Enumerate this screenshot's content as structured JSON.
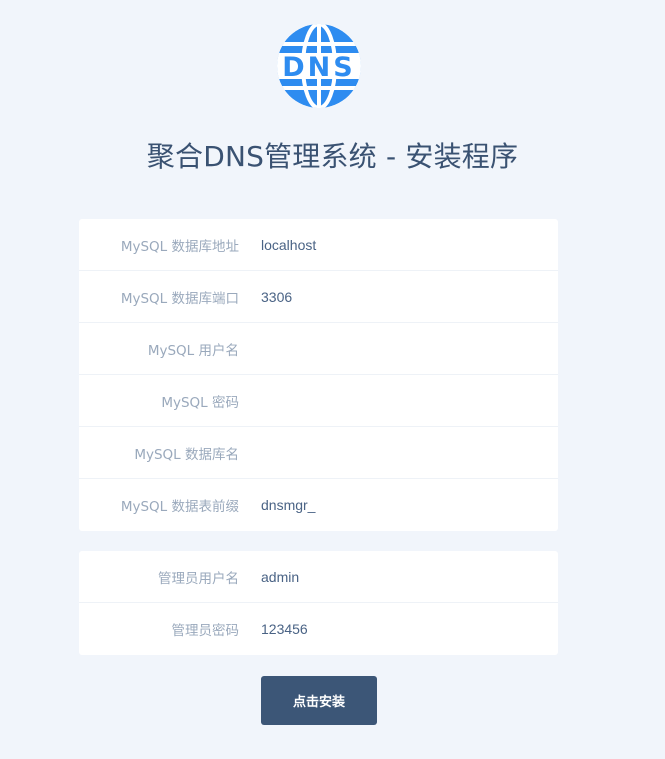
{
  "header": {
    "logo_text": "DNS",
    "logo_color": "#2e8cf0",
    "title": "聚合DNS管理系统 - 安装程序"
  },
  "database": {
    "fields": [
      {
        "label": "MySQL 数据库地址",
        "value": "localhost"
      },
      {
        "label": "MySQL 数据库端口",
        "value": "3306"
      },
      {
        "label": "MySQL 用户名",
        "value": ""
      },
      {
        "label": "MySQL 密码",
        "value": ""
      },
      {
        "label": "MySQL 数据库名",
        "value": ""
      },
      {
        "label": "MySQL 数据表前缀",
        "value": "dnsmgr_"
      }
    ]
  },
  "admin": {
    "fields": [
      {
        "label": "管理员用户名",
        "value": "admin"
      },
      {
        "label": "管理员密码",
        "value": "123456"
      }
    ]
  },
  "actions": {
    "install_label": "点击安装"
  },
  "colors": {
    "background": "#f1f5fb",
    "button": "#3c5677",
    "label": "#9aa9bc"
  }
}
